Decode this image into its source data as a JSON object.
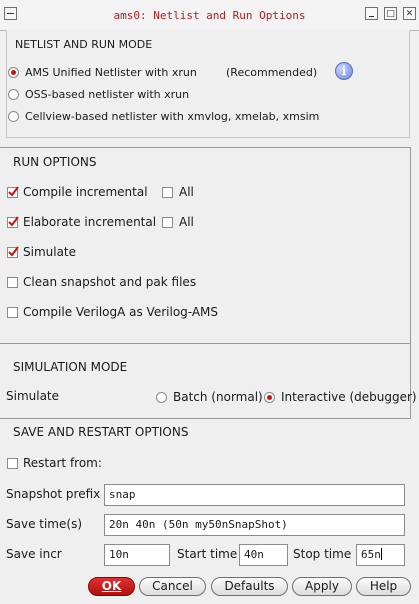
{
  "window": {
    "title": "ams0: Netlist and Run Options",
    "buttons": {
      "menu": "",
      "minimize": "",
      "maximize": "□",
      "close": "✕"
    }
  },
  "netlist_mode": {
    "heading": "NETLIST AND RUN MODE",
    "options": [
      {
        "label": "AMS Unified Netlister with xrun",
        "selected": true
      },
      {
        "label": "OSS-based netlister with xrun",
        "selected": false
      },
      {
        "label": "Cellview-based netlister with xmvlog, xmelab, xmsim",
        "selected": false
      }
    ],
    "recommended": "(Recommended)",
    "info_icon": "info-icon"
  },
  "run_options": {
    "heading": "RUN OPTIONS",
    "items": [
      {
        "label": "Compile incremental",
        "checked": true,
        "all_label": "All",
        "all_checked": false
      },
      {
        "label": "Elaborate incremental",
        "checked": true,
        "all_label": "All",
        "all_checked": false
      },
      {
        "label": "Simulate",
        "checked": true
      },
      {
        "label": "Clean snapshot and pak files",
        "checked": false
      },
      {
        "label": "Compile VerilogA as Verilog-AMS",
        "checked": false
      }
    ]
  },
  "simulation_mode": {
    "heading": "SIMULATION MODE",
    "label": "Simulate",
    "options": [
      {
        "label": "Batch (normal)",
        "selected": false
      },
      {
        "label": "Interactive (debugger)",
        "selected": true
      }
    ]
  },
  "save_restart": {
    "heading": "SAVE AND RESTART OPTIONS",
    "restart_label": "Restart from:",
    "restart_checked": false,
    "snapshot_prefix_label": "Snapshot prefix",
    "snapshot_prefix_value": "snap",
    "save_times_label": "Save time(s)",
    "save_times_value": "20n 40n (50n my50nSnapShot)",
    "save_incr_label": "Save incr",
    "save_incr_value": "10n",
    "start_time_label": "Start time",
    "start_time_value": "40n",
    "stop_time_label": "Stop time",
    "stop_time_value": "65n"
  },
  "footer": {
    "ok": "OK",
    "cancel": "Cancel",
    "defaults": "Defaults",
    "apply": "Apply",
    "help": "Help"
  },
  "colors": {
    "accent": "#d01010",
    "title_text": "#b02020",
    "info": "#6e86d6"
  }
}
